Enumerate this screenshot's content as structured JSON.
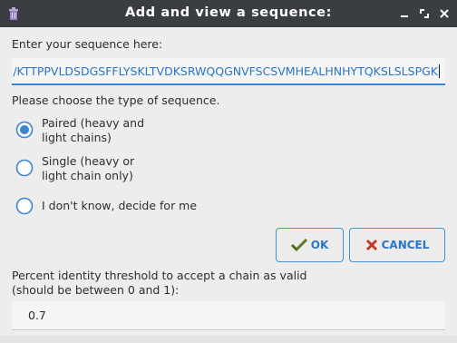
{
  "window": {
    "title": "Add and view a sequence:",
    "app_icon": "trash-can-icon",
    "controls": [
      "minimize-icon",
      "maximize-icon",
      "close-icon"
    ]
  },
  "sequence": {
    "label": "Enter your sequence here:",
    "value": "/KTTPPVLDSDGSFFLYSKLTVDKSRWQQGNVFSCSVMHEALHNHYTQKSLSLSPGK"
  },
  "sequence_type": {
    "label": "Please choose the type of sequence.",
    "selected": "paired",
    "options": [
      {
        "id": "paired",
        "line1": "Paired (heavy and",
        "line2": "light chains)"
      },
      {
        "id": "single",
        "line1": "Single (heavy or",
        "line2": "light chain only)"
      },
      {
        "id": "auto",
        "line1": "I don't know, decide for me"
      }
    ]
  },
  "buttons": {
    "ok_label": "OK",
    "cancel_label": "CANCEL"
  },
  "threshold": {
    "label_line1": "Percent identity threshold to accept a chain as valid",
    "label_line2": "(should be between 0 and 1):",
    "value": "0.7"
  },
  "colors": {
    "titlebar": "#3a3d42",
    "accent": "#3a86d1",
    "background": "#ededed",
    "cancel_x": "#c0392b",
    "ok_check": "#5f7a2e"
  }
}
